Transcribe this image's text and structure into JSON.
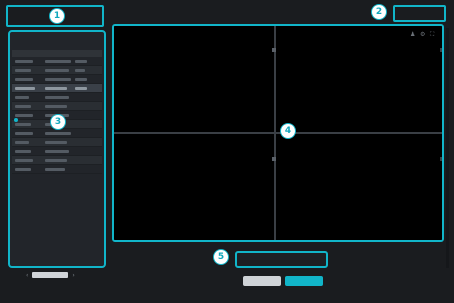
{
  "window": {
    "title": ""
  },
  "callouts": [
    "1",
    "2",
    "3",
    "4",
    "5"
  ],
  "left_panel": {
    "label": "",
    "action_label": "",
    "columns": [
      "",
      "",
      ""
    ],
    "rows": [
      {
        "selected": false
      },
      {
        "selected": false
      },
      {
        "selected": false
      },
      {
        "selected": true
      },
      {
        "selected": false
      },
      {
        "selected": false
      },
      {
        "selected": false
      },
      {
        "selected": false
      },
      {
        "selected": false
      },
      {
        "selected": false
      },
      {
        "selected": false
      },
      {
        "selected": false
      },
      {
        "selected": false
      }
    ]
  },
  "pager": {
    "prev_icon": "chevron-left-icon",
    "next_icon": "chevron-right-icon"
  },
  "video": {
    "cells": [
      {
        "label": ""
      },
      {
        "label": ""
      },
      {
        "label": ""
      },
      {
        "label": ""
      }
    ],
    "toolbar_icons": [
      "user-icon",
      "settings-icon",
      "fullscreen-icon"
    ]
  },
  "timeline": {
    "label": ""
  },
  "footer": {
    "cancel_label": "",
    "ok_label": ""
  },
  "colors": {
    "accent": "#11b5c9",
    "background": "#1a1c1f",
    "panel": "#22252a"
  }
}
